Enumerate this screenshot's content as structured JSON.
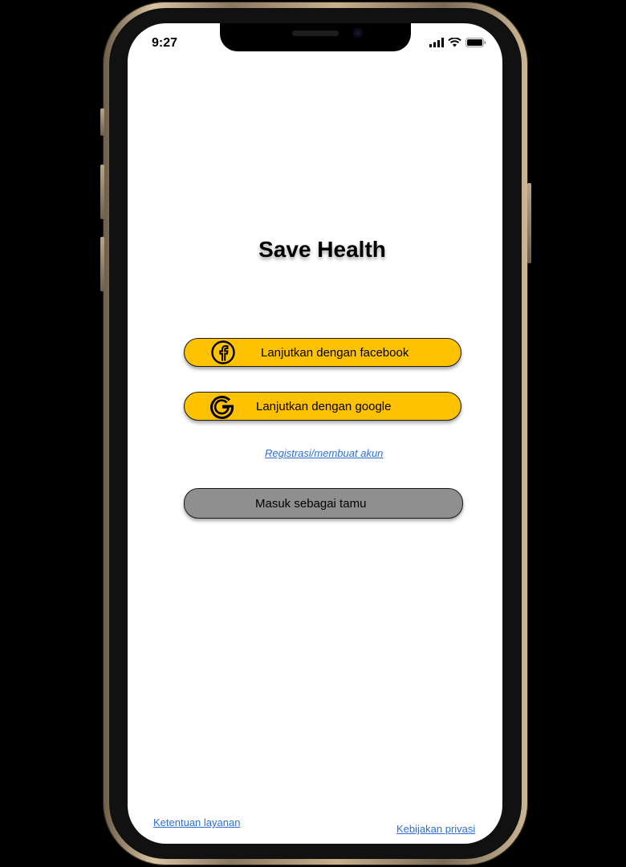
{
  "status_bar": {
    "time": "9:27",
    "icons": [
      "signal-icon",
      "wifi-icon",
      "battery-icon"
    ]
  },
  "app": {
    "title": "Save Health"
  },
  "buttons": {
    "facebook": {
      "label": "Lanjutkan dengan facebook",
      "icon": "facebook-icon"
    },
    "google": {
      "label": "Lanjutkan dengan google",
      "icon": "google-icon"
    },
    "guest": {
      "label": "Masuk sebagai tamu"
    }
  },
  "links": {
    "register": "Registrasi/membuat akun",
    "terms": "Ketentuan layanan",
    "privacy": "Kebijakan privasi"
  },
  "colors": {
    "accent_yellow": "#ffc200",
    "guest_gray": "#8f8f8f",
    "link_blue": "#2f6fd6"
  }
}
